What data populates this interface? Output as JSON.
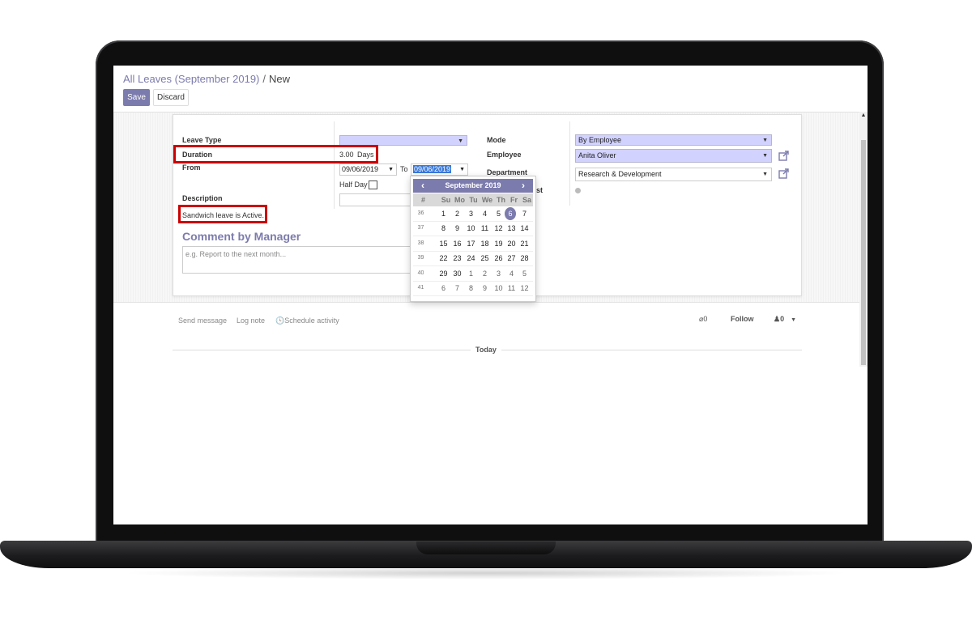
{
  "breadcrumb": {
    "parent": "All Leaves (September 2019)",
    "separator": "/",
    "current": "New"
  },
  "toolbar": {
    "save_label": "Save",
    "discard_label": "Discard"
  },
  "form": {
    "leave_type_label": "Leave Type",
    "leave_type_value": "",
    "duration_label": "Duration",
    "duration_value": "3.00",
    "duration_unit": "Days",
    "from_label": "From",
    "from_date": "09/06/2019",
    "to_label": "To",
    "to_date": "09/06/2019",
    "half_day_label": "Half Day",
    "description_label": "Description",
    "sandwich_note": "Sandwich leave is Active.",
    "mode_label": "Mode",
    "mode_value": "By Employee",
    "employee_label": "Employee",
    "employee_value": "Anita Oliver",
    "department_label": "Department",
    "department_value": "Research & Development",
    "hidden_label_fragment": "st"
  },
  "manager": {
    "title": "Comment by Manager",
    "placeholder": "e.g. Report to the next month..."
  },
  "chatter": {
    "send_message": "Send message",
    "log_note": "Log note",
    "schedule_activity": "Schedule activity",
    "attachments_count": "0",
    "follow_label": "Follow",
    "followers_count": "0",
    "today_label": "Today"
  },
  "datepicker": {
    "month_label": "September 2019",
    "week_header": "#",
    "weekdays": [
      "Su",
      "Mo",
      "Tu",
      "We",
      "Th",
      "Fr",
      "Sa"
    ],
    "weeks": [
      {
        "wk": "36",
        "days": [
          "1",
          "2",
          "3",
          "4",
          "5",
          "6",
          "7"
        ]
      },
      {
        "wk": "37",
        "days": [
          "8",
          "9",
          "10",
          "11",
          "12",
          "13",
          "14"
        ]
      },
      {
        "wk": "38",
        "days": [
          "15",
          "16",
          "17",
          "18",
          "19",
          "20",
          "21"
        ]
      },
      {
        "wk": "39",
        "days": [
          "22",
          "23",
          "24",
          "25",
          "26",
          "27",
          "28"
        ]
      },
      {
        "wk": "40",
        "days": [
          "29",
          "30",
          "1",
          "2",
          "3",
          "4",
          "5"
        ]
      },
      {
        "wk": "41",
        "days": [
          "6",
          "7",
          "8",
          "9",
          "10",
          "11",
          "12"
        ]
      }
    ],
    "selected_day": "6"
  },
  "colors": {
    "accent": "#7c7bad",
    "required_field": "#d2d2ff",
    "highlight": "#cc0000"
  },
  "icons": [
    "chevron-left-icon",
    "chevron-right-icon",
    "external-link-icon",
    "paperclip-icon",
    "clock-icon",
    "user-icon",
    "caret-down-icon"
  ]
}
